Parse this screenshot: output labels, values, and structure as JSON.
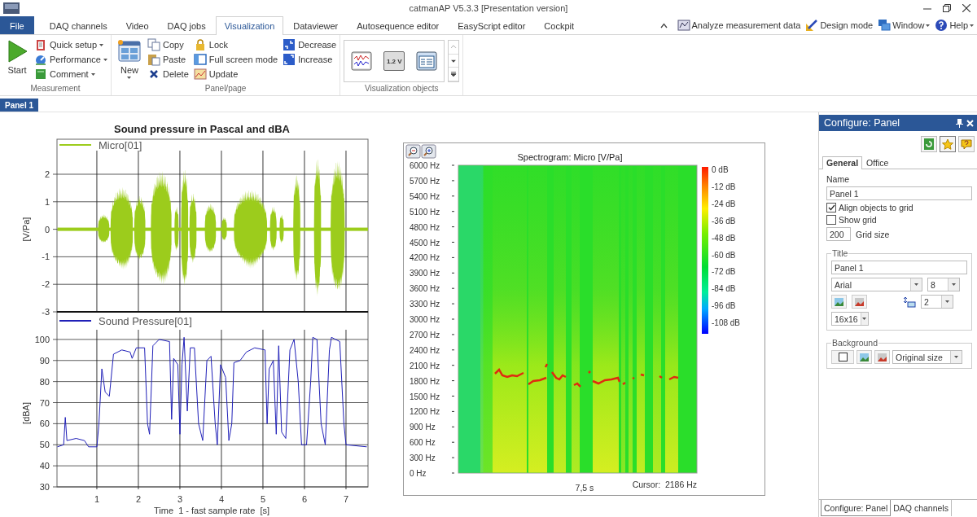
{
  "window": {
    "title": "catmanAP V5.3.3 [Presentation version]"
  },
  "menu_tabs": [
    {
      "label": "File",
      "kind": "file",
      "selected": false
    },
    {
      "label": "DAQ channels",
      "kind": "tab",
      "selected": false
    },
    {
      "label": "Video",
      "kind": "tab",
      "selected": false
    },
    {
      "label": "DAQ jobs",
      "kind": "tab",
      "selected": false
    },
    {
      "label": "Visualization",
      "kind": "tab",
      "selected": true
    },
    {
      "label": "Dataviewer",
      "kind": "tab",
      "selected": false
    },
    {
      "label": "Autosequence editor",
      "kind": "tab",
      "selected": false
    },
    {
      "label": "EasyScript editor",
      "kind": "tab",
      "selected": false
    },
    {
      "label": "Cockpit",
      "kind": "tab",
      "selected": false
    }
  ],
  "quick_links": [
    {
      "label": "Analyze measurement data",
      "dropdown": false
    },
    {
      "label": "Design mode",
      "dropdown": false
    },
    {
      "label": "Window",
      "dropdown": true
    },
    {
      "label": "Help",
      "dropdown": true
    }
  ],
  "ribbon": {
    "groups": [
      {
        "label": "Measurement",
        "large": [
          {
            "label": "Start",
            "dropdown": false
          }
        ],
        "small": [
          {
            "label": "Quick setup",
            "dropdown": true
          },
          {
            "label": "Performance",
            "dropdown": true
          },
          {
            "label": "Comment",
            "dropdown": true
          }
        ]
      },
      {
        "label": "Panel/page",
        "large": [
          {
            "label": "New",
            "dropdown": true
          }
        ],
        "small": [
          {
            "label": "Copy",
            "dropdown": false
          },
          {
            "label": "Paste",
            "dropdown": false
          },
          {
            "label": "Delete",
            "dropdown": false
          },
          {
            "label": "Lock",
            "dropdown": false
          },
          {
            "label": "Full screen mode",
            "dropdown": false
          },
          {
            "label": "Update",
            "dropdown": false
          },
          {
            "label": "Decrease",
            "dropdown": false
          },
          {
            "label": "Increase",
            "dropdown": false
          }
        ]
      },
      {
        "label": "Visualization objects",
        "gallery": [
          {
            "kind": "chart"
          },
          {
            "kind": "display",
            "label": "1.2 V"
          },
          {
            "kind": "list"
          }
        ]
      }
    ]
  },
  "doc_tabs": [
    {
      "label": "Panel 1",
      "selected": true
    }
  ],
  "time_chart": {
    "title": "Sound pressure in Pascal and dBA",
    "waveform": {
      "legend": "Micro[01]",
      "ylabel": "[V/Pa]",
      "color": "#9ccc1c",
      "yticks": [
        "2",
        "1",
        "0",
        "-1",
        "-2",
        "-3"
      ]
    },
    "chart_data": {
      "type": "line",
      "xlabel": "Time  1 - fast sample rate  [s]",
      "ylabel": "[dBA]",
      "xticks": [
        1,
        2,
        3,
        4,
        5,
        6,
        7
      ],
      "yticks": [
        100,
        90,
        80,
        70,
        60,
        50,
        40,
        30
      ],
      "xlim": [
        0.04,
        7.53
      ],
      "ylim": [
        30,
        113.1
      ],
      "grid": true,
      "x": [
        0.05,
        0.2,
        0.24,
        0.28,
        0.5,
        0.7,
        0.8,
        1.0,
        1.05,
        1.12,
        1.2,
        1.3,
        1.4,
        1.6,
        1.8,
        1.85,
        1.95,
        2.15,
        2.22,
        2.27,
        2.35,
        2.5,
        2.75,
        2.8,
        2.85,
        2.95,
        3.0,
        3.05,
        3.1,
        3.18,
        3.25,
        3.35,
        3.45,
        3.55,
        3.65,
        3.75,
        3.85,
        3.9,
        3.98,
        4.1,
        4.18,
        4.25,
        4.3,
        4.45,
        4.6,
        4.8,
        5.05,
        5.1,
        5.15,
        5.25,
        5.32,
        5.38,
        5.45,
        5.55,
        5.65,
        5.75,
        5.85,
        5.93,
        6.05,
        6.15,
        6.2,
        6.3,
        6.4,
        6.5,
        6.6,
        6.65,
        6.85,
        6.95,
        7.0,
        7.5
      ],
      "series": [
        {
          "name": "Sound Pressure[01]",
          "color": "#2020b8",
          "values": [
            49,
            50,
            63,
            52,
            53,
            52,
            49,
            49,
            60,
            86,
            75,
            73,
            93,
            95,
            94,
            91,
            96,
            96,
            60,
            55,
            97,
            100,
            99,
            62,
            91,
            88,
            55,
            88,
            101,
            66,
            96,
            96,
            60,
            52,
            90,
            92,
            60,
            50,
            88,
            82,
            52,
            60,
            89,
            90,
            94,
            96,
            95,
            60,
            86,
            90,
            55,
            97,
            56,
            53,
            95,
            100,
            80,
            50,
            50,
            80,
            101,
            100,
            60,
            50,
            95,
            101,
            99,
            60,
            50,
            49
          ]
        }
      ]
    }
  },
  "spectrogram": {
    "title": "Spectrogram: Micro [V/Pa]",
    "yticks": [
      "6000 Hz",
      "5700 Hz",
      "5400 Hz",
      "5100 Hz",
      "4800 Hz",
      "4500 Hz",
      "4200 Hz",
      "3900 Hz",
      "3600 Hz",
      "3300 Hz",
      "3000 Hz",
      "2700 Hz",
      "2400 Hz",
      "2100 Hz",
      "1800 Hz",
      "1500 Hz",
      "1200 Hz",
      "900 Hz",
      "600 Hz",
      "300 Hz",
      "0 Hz"
    ],
    "scale_labels": [
      "0 dB",
      "-12 dB",
      "-24 dB",
      "-36 dB",
      "-48 dB",
      "-60 dB",
      "-72 dB",
      "-84 dB",
      "-96 dB",
      "-108 dB"
    ],
    "time_label": "7,5 s",
    "cursor": "Cursor:  2186 Hz"
  },
  "configure": {
    "title": "Configure: Panel",
    "tabs": [
      {
        "label": "General",
        "selected": true
      },
      {
        "label": "Office",
        "selected": false
      }
    ],
    "name_label": "Name",
    "name_value": "Panel 1",
    "checkboxes": [
      {
        "label": "Align objects to grid",
        "checked": true
      },
      {
        "label": "Show grid",
        "checked": false
      }
    ],
    "grid_size": {
      "value": "200",
      "label": "Grid size"
    },
    "title_group": {
      "label": "Title",
      "text": "Panel 1",
      "font": "Arial",
      "size": "8",
      "spacing": "2",
      "icon_size": "16x16"
    },
    "background_group": {
      "label": "Background",
      "mode": "Original size"
    },
    "bottom_tabs": [
      {
        "label": "Configure: Panel",
        "selected": true
      },
      {
        "label": "DAQ channels",
        "selected": false
      }
    ]
  }
}
